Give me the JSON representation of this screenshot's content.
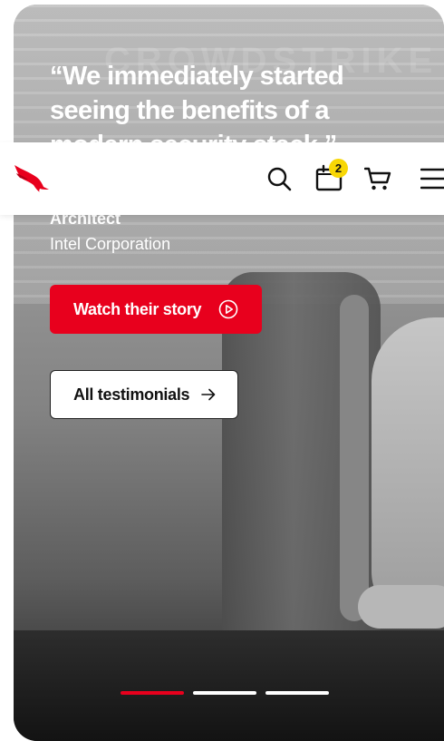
{
  "header": {
    "logo_icon": "crowdstrike-falcon-logo-icon",
    "search_icon": "search-icon",
    "calendar_icon": "calendar-icon",
    "calendar_badge": "2",
    "cart_icon": "cart-icon",
    "menu_icon": "hamburger-menu-icon",
    "badge_color": "#f8d705"
  },
  "hero": {
    "watermark": "CROWDSTRIKE",
    "quote": "“We immediately started seeing the benefits of a modern security stack.”",
    "person_role": "Architect",
    "person_company": "Intel Corporation",
    "watch_button": "Watch their story",
    "watch_icon": "play-circle-icon",
    "all_button": "All testimonials",
    "all_icon": "arrow-right-icon",
    "accent_color": "#e8001d",
    "carousel": {
      "total": 3,
      "active_index": 0
    }
  }
}
